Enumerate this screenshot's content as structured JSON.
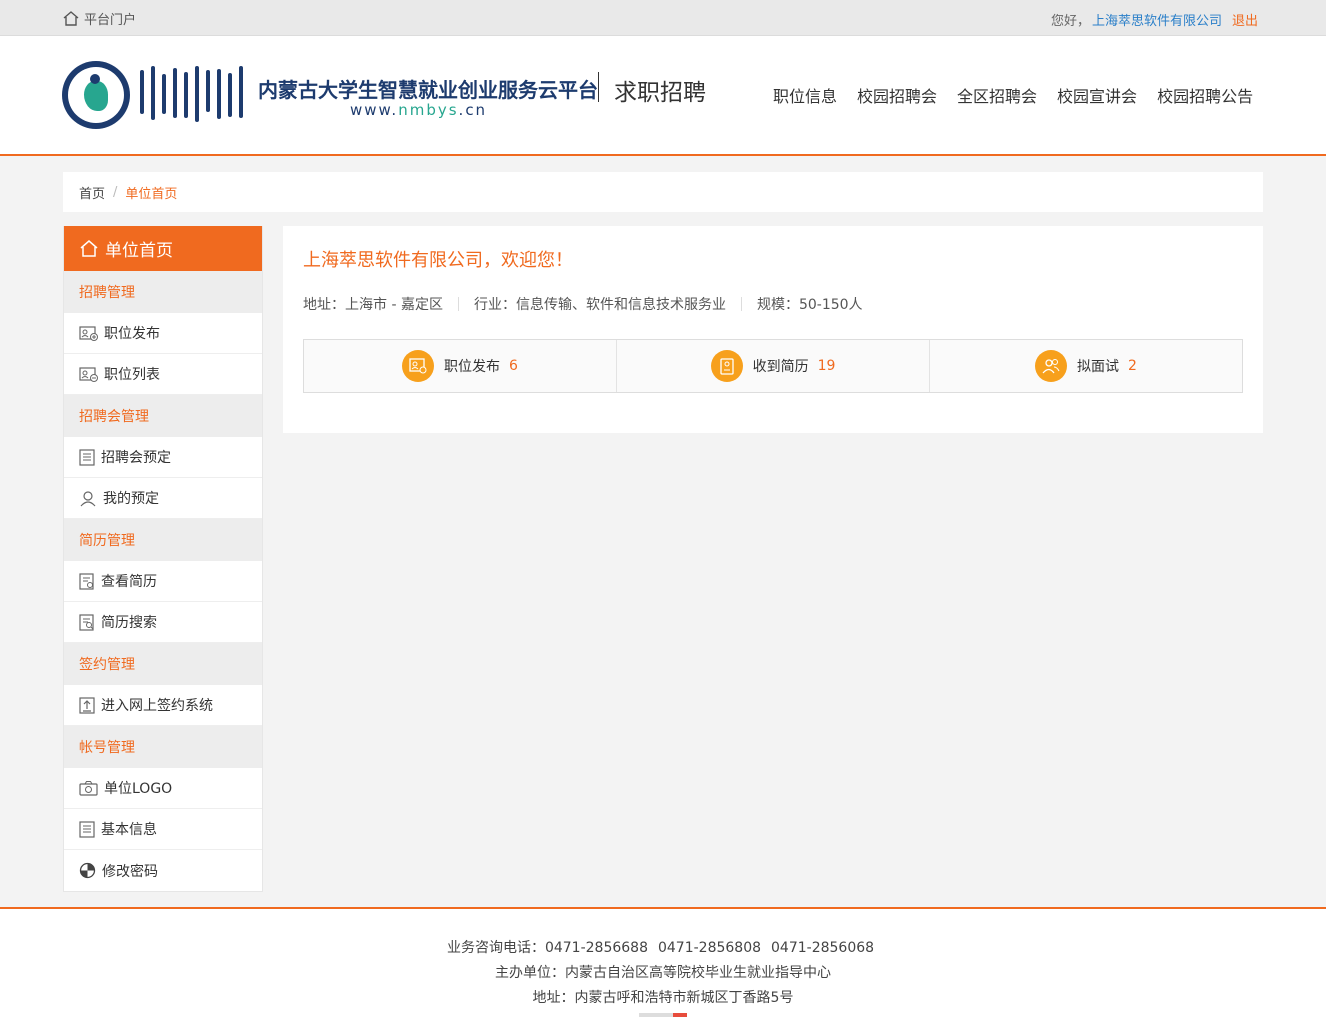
{
  "topbar": {
    "portal_label": "平台门户",
    "greeting": "您好，",
    "company": "上海萃思软件有限公司",
    "logout": "退出"
  },
  "header": {
    "site_name": "内蒙古大学生智慧就业创业服务云平台",
    "site_url_prefix": "www.",
    "site_url_domain": "nmbys",
    "site_url_suffix": ".cn",
    "section_name": "求职招聘",
    "nav": [
      "职位信息",
      "校园招聘会",
      "全区招聘会",
      "校园宣讲会",
      "校园招聘公告"
    ]
  },
  "breadcrumb": {
    "home": "首页",
    "separator": "/",
    "current": "单位首页"
  },
  "sidebar": {
    "title": "单位首页",
    "groups": [
      {
        "label": "招聘管理",
        "items": [
          "职位发布",
          "职位列表"
        ]
      },
      {
        "label": "招聘会管理",
        "items": [
          "招聘会预定",
          "我的预定"
        ]
      },
      {
        "label": "简历管理",
        "items": [
          "查看简历",
          "简历搜索"
        ]
      },
      {
        "label": "签约管理",
        "items": [
          "进入网上签约系统"
        ]
      },
      {
        "label": "帐号管理",
        "items": [
          "单位LOGO",
          "基本信息",
          "修改密码"
        ]
      }
    ]
  },
  "main": {
    "welcome": "上海萃思软件有限公司，欢迎您！",
    "address": "地址：上海市 - 嘉定区",
    "industry": "行业：信息传输、软件和信息技术服务业",
    "scale": "规模：50-150人",
    "stats": [
      {
        "label": "职位发布",
        "value": "6",
        "icon": "job-post-icon"
      },
      {
        "label": "收到简历",
        "value": "19",
        "icon": "resume-icon"
      },
      {
        "label": "拟面试",
        "value": "2",
        "icon": "interview-icon"
      }
    ]
  },
  "footer": {
    "phone_label": "业务咨询电话：",
    "phones": [
      "0471-2856688",
      "0471-2856808",
      "0471-2856068"
    ],
    "host": "主办单位：内蒙古自治区高等院校毕业生就业指导中心",
    "address": "地址：内蒙古呼和浩特市新城区丁香路5号"
  },
  "colors": {
    "accent": "#f06a1f",
    "link": "#2a7fc9",
    "stat_icon_bg": "#f7a01c",
    "brand_navy": "#1d3b6e",
    "brand_green": "#27a68f"
  }
}
